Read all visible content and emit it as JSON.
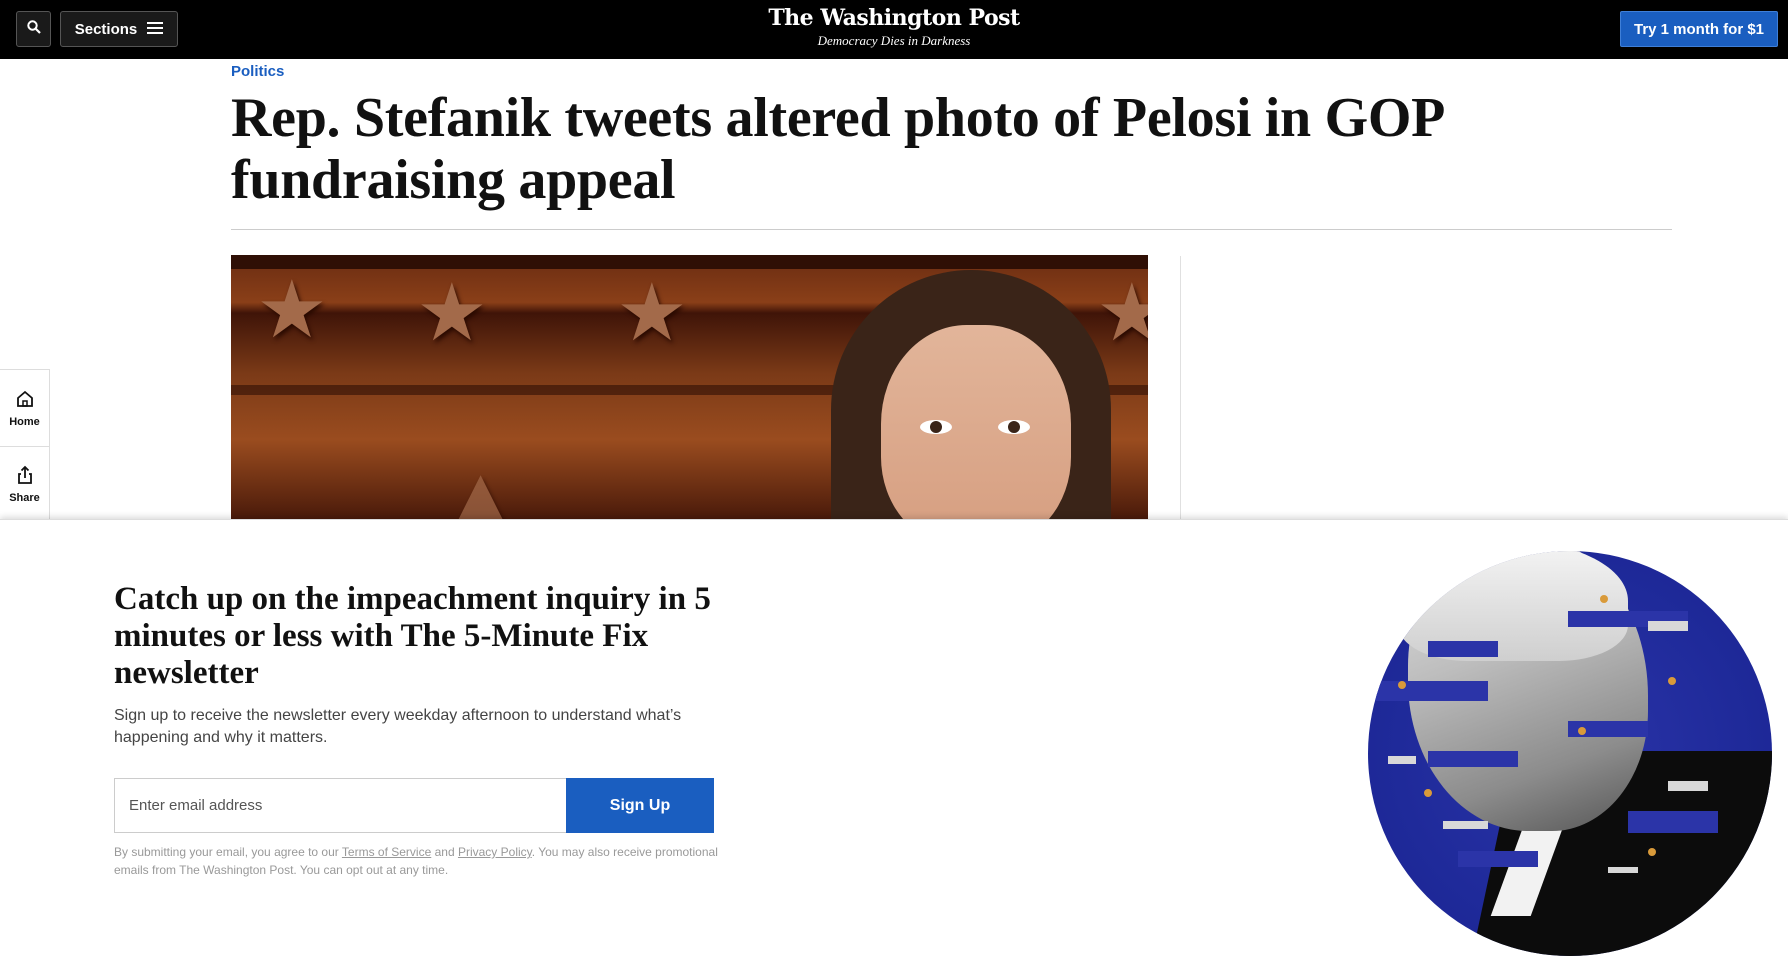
{
  "header": {
    "sections_label": "Sections",
    "logo": "The Washington Post",
    "tagline": "Democracy Dies in Darkness",
    "subscribe_label": "Try 1 month for $1"
  },
  "rail": {
    "home_label": "Home",
    "share_label": "Share"
  },
  "article": {
    "kicker": "Politics",
    "headline": "Rep. Stefanik tweets altered photo of Pelosi in GOP fundraising appeal"
  },
  "newsletter": {
    "title": "Catch up on the impeachment inquiry in 5 minutes or less with The 5-Minute Fix newsletter",
    "description": "Sign up to receive the newsletter every weekday afternoon to understand what’s happening and why it matters.",
    "email_placeholder": "Enter email address",
    "signup_label": "Sign Up",
    "legal_pre": "By submitting your email, you agree to our ",
    "terms_label": "Terms of Service",
    "legal_and": " and ",
    "privacy_label": "Privacy Policy",
    "legal_post": ". You may also receive promotional emails from The Washington Post. You can opt out at any time."
  },
  "colors": {
    "accent": "#1a5ec0",
    "topbar": "#000000"
  }
}
